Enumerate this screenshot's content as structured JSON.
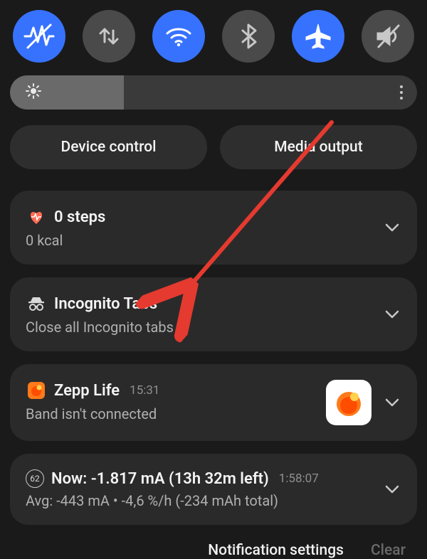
{
  "quick_settings": {
    "items": [
      {
        "name": "vitals",
        "active": true
      },
      {
        "name": "data-swap",
        "active": false
      },
      {
        "name": "wifi",
        "active": true
      },
      {
        "name": "bluetooth",
        "active": false
      },
      {
        "name": "airplane",
        "active": true
      },
      {
        "name": "mute",
        "active": false
      }
    ],
    "brightness_percent": 28
  },
  "pills": {
    "device_control": "Device control",
    "media_output": "Media output"
  },
  "notifications": [
    {
      "app": "heart-monitor",
      "title": "0 steps",
      "subtitle": "0 kcal",
      "time": ""
    },
    {
      "app": "incognito",
      "title": "Incognito Tabs",
      "subtitle": "Close all Incognito tabs",
      "time": ""
    },
    {
      "app": "zepp-life",
      "title": "Zepp Life",
      "subtitle": "Band isn't connected",
      "time": "15:31",
      "thumb": "zepp"
    },
    {
      "app": "battery",
      "title": "Now: -1.817 mA (13h 32m left)",
      "subtitle": "Avg: -443 mA • -4,6 %/h (-234 mAh total)",
      "time": "1:58:07",
      "badge": "62"
    }
  ],
  "footer": {
    "settings": "Notification settings",
    "clear": "Clear"
  },
  "annotation": {
    "arrow_color": "#e53a2f"
  }
}
